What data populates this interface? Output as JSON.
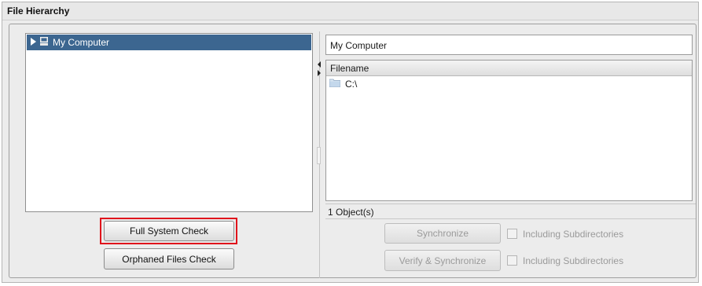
{
  "panel": {
    "title": "File Hierarchy"
  },
  "tree": {
    "items": [
      {
        "label": "My Computer",
        "selected": true,
        "icon": "computer-icon"
      }
    ]
  },
  "actions": {
    "full_system_check": "Full System Check",
    "orphaned_files_check": "Orphaned Files Check"
  },
  "details": {
    "path": "My Computer",
    "column_header": "Filename",
    "files": [
      {
        "name": "C:\\",
        "icon": "folder-icon"
      }
    ],
    "object_count": "1 Object(s)"
  },
  "sync": {
    "synchronize_label": "Synchronize",
    "verify_synchronize_label": "Verify & Synchronize",
    "include_subdirs_label_1": "Including Subdirectories",
    "include_subdirs_label_2": "Including Subdirectories"
  },
  "colors": {
    "selection": "#3c6690",
    "highlight_border": "#e0141c",
    "disabled_text": "#9a9a9a"
  }
}
